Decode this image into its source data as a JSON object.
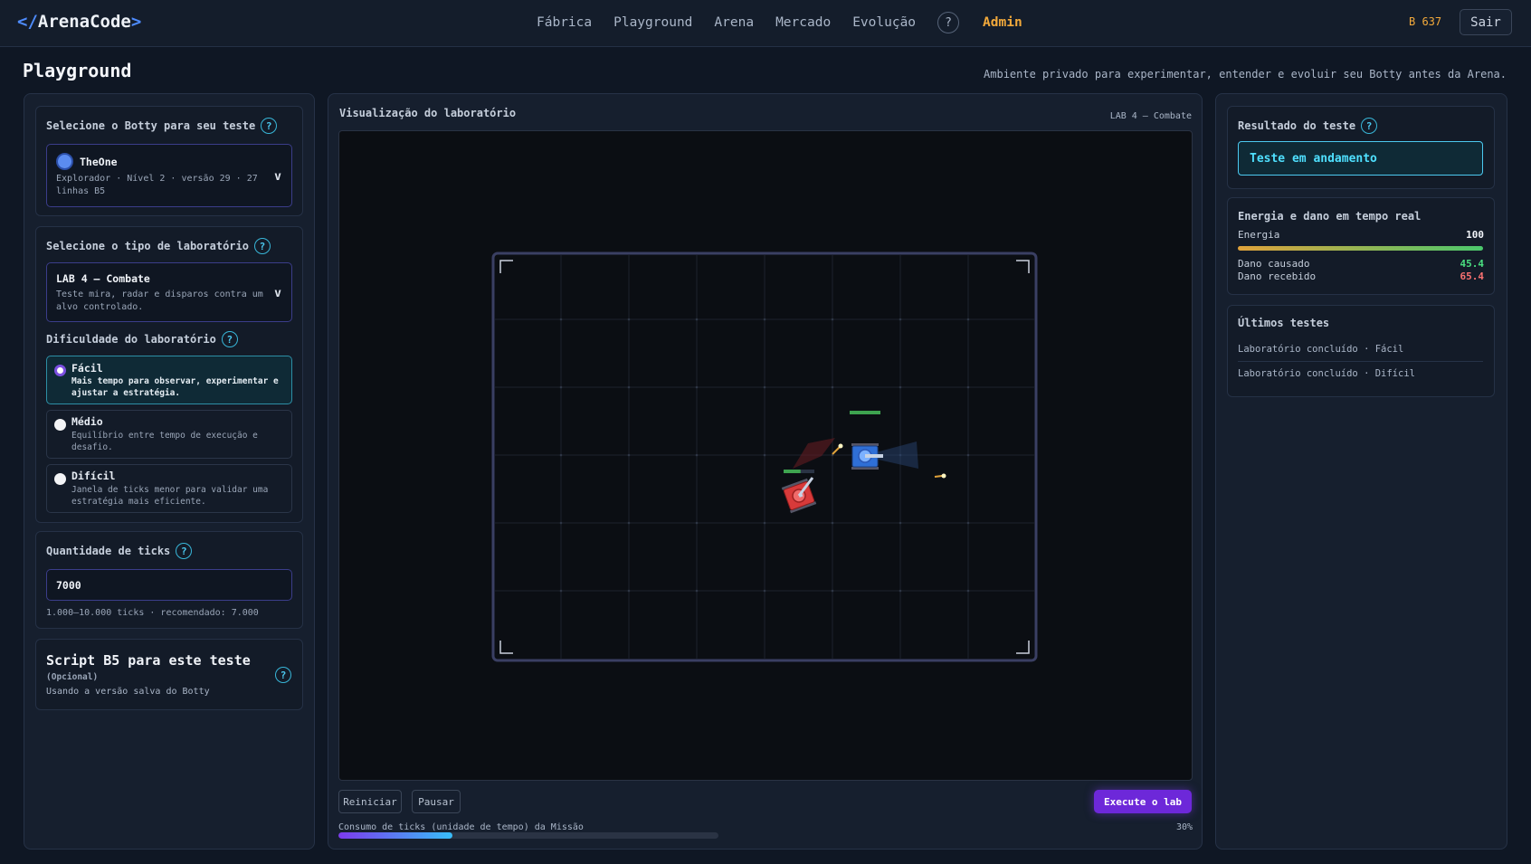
{
  "app": {
    "logo_open": "</",
    "logo_name": "ArenaCode",
    "logo_close": ">"
  },
  "nav": {
    "items": [
      "Fábrica",
      "Playground",
      "Arena",
      "Mercado",
      "Evolução"
    ],
    "help": "?",
    "admin": "Admin"
  },
  "account": {
    "balance": "B 637",
    "logout": "Sair"
  },
  "page": {
    "title": "Playground",
    "subtitle": "Ambiente privado para experimentar, entender e evoluir seu Botty antes da Arena."
  },
  "left": {
    "botty": {
      "title": "Selecione o Botty para seu teste",
      "name": "TheOne",
      "meta": "Explorador · Nível 2 · versão 29 · 27 linhas B5",
      "chevron": "v"
    },
    "lab": {
      "title": "Selecione o tipo de laboratório",
      "name": "LAB 4 — Combate",
      "desc": "Teste mira, radar e disparos contra um alvo controlado.",
      "chevron": "v"
    },
    "difficulty": {
      "title": "Dificuldade do laboratório",
      "options": [
        {
          "label": "Fácil",
          "desc": "Mais tempo para observar, experimentar e ajustar a estratégia.",
          "selected": true
        },
        {
          "label": "Médio",
          "desc": "Equilíbrio entre tempo de execução e desafio.",
          "selected": false
        },
        {
          "label": "Difícil",
          "desc": "Janela de ticks menor para validar uma estratégia mais eficiente.",
          "selected": false
        }
      ]
    },
    "ticks": {
      "title": "Quantidade de ticks",
      "value": "7000",
      "hint": "1.000–10.000 ticks · recomendado: 7.000"
    },
    "script": {
      "title": "Script B5 para este teste",
      "optional": "(Opcional)",
      "note": "Usando a versão salva do Botty"
    }
  },
  "center": {
    "title": "Visualização do laboratório",
    "lab_tag": "LAB 4 — Combate",
    "restart": "Reiniciar",
    "pause": "Pausar",
    "run": "Execute o lab",
    "progress_label": "Consumo de ticks (unidade de tempo) da Missão",
    "progress_pct": "30%",
    "progress_value": 0.3,
    "blue_health": 1.0,
    "red_health": 0.55
  },
  "right": {
    "result": {
      "title": "Resultado do teste",
      "status": "Teste em andamento"
    },
    "energy": {
      "title": "Energia e dano em tempo real",
      "energy_label": "Energia",
      "energy_value": "100",
      "energy_fraction": 1.0,
      "dealt_label": "Dano causado",
      "dealt_value": "45.4",
      "taken_label": "Dano recebido",
      "taken_value": "65.4"
    },
    "history": {
      "title": "Últimos testes",
      "items": [
        "Laboratório concluído · Fácil",
        "Laboratório concluído · Difícil"
      ]
    }
  },
  "colors": {
    "accent": "#4cc9f0",
    "brand": "#7c3aed",
    "gold": "#f2a93b",
    "positive": "#4ade80",
    "negative": "#f87171"
  }
}
